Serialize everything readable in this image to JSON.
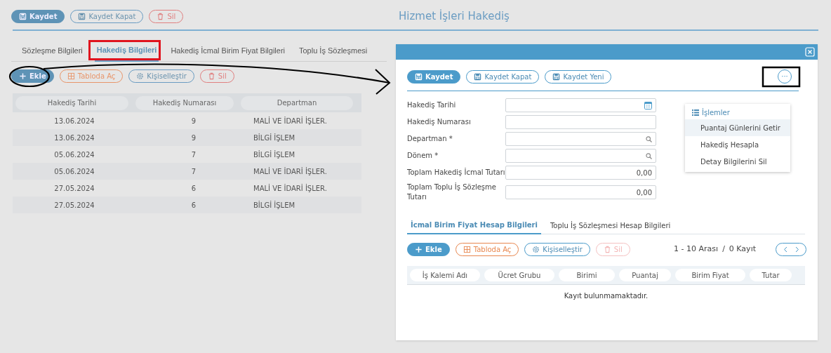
{
  "toolbar": [
    {
      "label": "Kaydet",
      "kind": "primary"
    },
    {
      "label": "Kaydet Kapat",
      "kind": "outline"
    },
    {
      "label": "Sil",
      "kind": "danger"
    }
  ],
  "page_title": "Hizmet İşleri Hakediş",
  "tabs": [
    {
      "label": "Sözleşme Bilgileri",
      "selected": false
    },
    {
      "label": "Hakediş Bilgileri",
      "selected": true
    },
    {
      "label": "Hakediş İcmal Birim Fiyat Bilgileri",
      "selected": false
    },
    {
      "label": "Toplu İş Sözleşmesi",
      "selected": false
    }
  ],
  "grid_toolbar": [
    {
      "label": "Ekle",
      "kind": "primary"
    },
    {
      "label": "Tabloda Aç",
      "kind": "warning"
    },
    {
      "label": "Kişiselleştir",
      "kind": "outline"
    },
    {
      "label": "Sil",
      "kind": "danger"
    }
  ],
  "table": {
    "columns": [
      "Hakediş Tarihi",
      "Hakediş Numarası",
      "Departman"
    ],
    "rows": [
      [
        "13.06.2024",
        "9",
        "MALİ VE İDARİ İŞLER."
      ],
      [
        "13.06.2024",
        "9",
        "BİLGİ İŞLEM"
      ],
      [
        "05.06.2024",
        "7",
        "BİLGİ İŞLEM"
      ],
      [
        "05.06.2024",
        "7",
        "MALİ VE İDARİ İŞLER."
      ],
      [
        "27.05.2024",
        "6",
        "MALİ VE İDARİ İŞLER."
      ],
      [
        "27.05.2024",
        "6",
        "BİLGİ İŞLEM"
      ]
    ]
  },
  "dialog": {
    "toolbar": [
      {
        "label": "Kaydet",
        "kind": "primary"
      },
      {
        "label": "Kaydet Kapat",
        "kind": "outline"
      },
      {
        "label": "Kaydet Yeni",
        "kind": "outline"
      }
    ],
    "more_button": "···",
    "menu": {
      "title": "İşlemler",
      "items": [
        {
          "label": "Puantaj Günlerini Getir",
          "selected": true
        },
        {
          "label": "Hakediş Hesapla",
          "selected": false
        },
        {
          "label": "Detay Bilgilerini Sil",
          "selected": false
        }
      ]
    },
    "form": [
      {
        "label": "Hakediş Tarihi",
        "kind": "date"
      },
      {
        "label": "Hakediş Numarası",
        "kind": "text"
      },
      {
        "label": "Departman *",
        "kind": "lookup"
      },
      {
        "label": "Dönem *",
        "kind": "lookup"
      },
      {
        "label": "Toplam Hakediş İcmal Tutarı",
        "kind": "number",
        "value": "0,00"
      },
      {
        "label": "Toplam Toplu İş Sözleşme Tutarı",
        "kind": "number",
        "value": "0,00"
      }
    ],
    "tabs": [
      {
        "label": "İcmal Birim Fiyat Hesap Bilgileri",
        "selected": true
      },
      {
        "label": "Toplu İş Sözleşmesi Hesap Bilgileri",
        "selected": false
      }
    ],
    "toolbar2": [
      {
        "label": "Ekle",
        "kind": "primary",
        "disabled": false
      },
      {
        "label": "Tabloda Aç",
        "kind": "warning",
        "disabled": false
      },
      {
        "label": "Kişiselleştir",
        "kind": "outline",
        "disabled": false
      },
      {
        "label": "Sil",
        "kind": "danger",
        "disabled": true
      }
    ],
    "pager": {
      "range": "1 - 10 Arası",
      "separator": "/",
      "count": "0 Kayıt"
    },
    "table": {
      "columns": [
        "İş Kalemi Adı",
        "Ücret Grubu",
        "Birimi",
        "Puantaj",
        "Birim Fiyat",
        "Tutar"
      ],
      "empty_message": "Kayıt bulunmamaktadır."
    }
  }
}
